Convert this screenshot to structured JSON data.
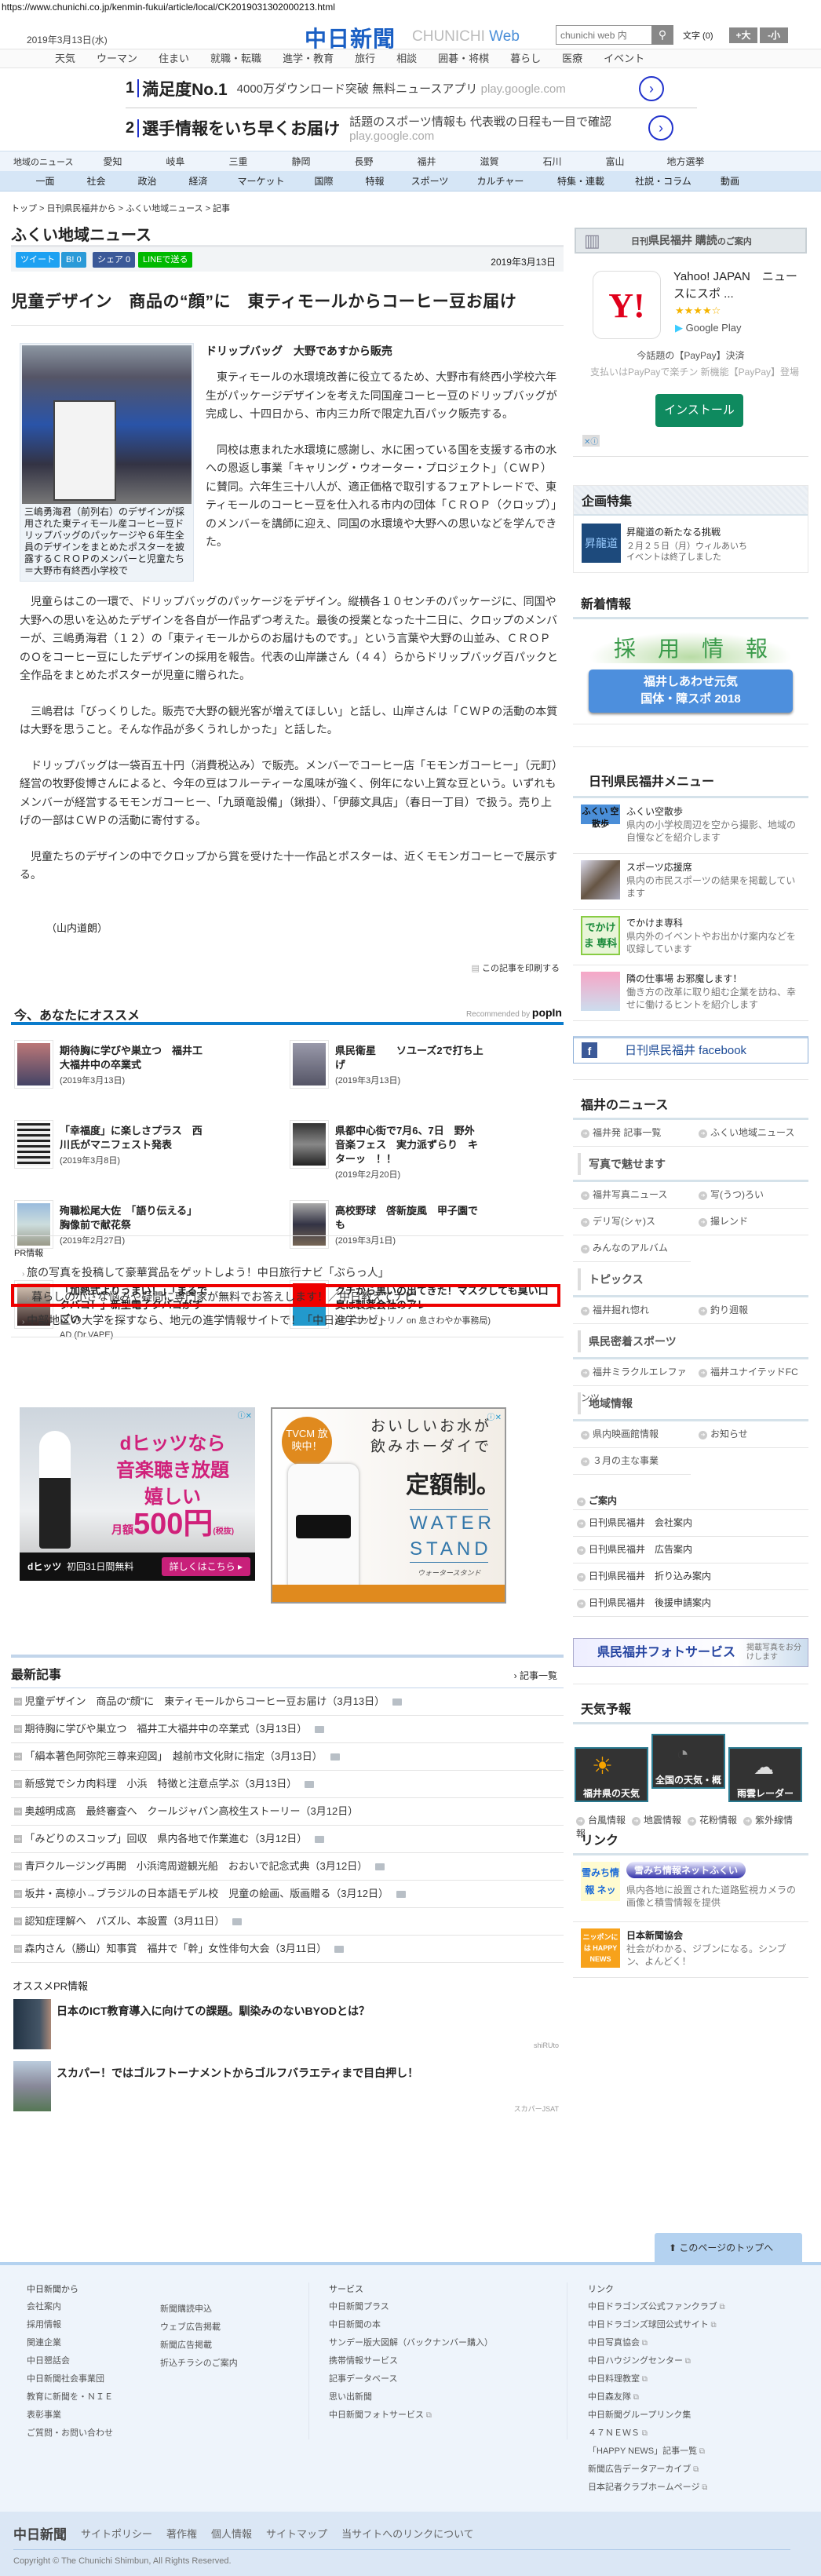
{
  "url": "https://www.chunichi.co.jp/kenmin-fukui/article/local/CK2019031302000213.html",
  "header": {
    "date": "2019年3月13日(水)",
    "logo": "中日新聞",
    "logo_sub": "CHUNICHI",
    "logo_web": "Web",
    "search_placeholder": "chunichi web 内",
    "font_label": "文字 (0)",
    "font_up": "+大",
    "font_down": "-小"
  },
  "top_nav": [
    "天気",
    "ウーマン",
    "住まい",
    "就職・転職",
    "進学・教育",
    "旅行",
    "相談",
    "囲碁・将棋",
    "暮らし",
    "医療",
    "イベント"
  ],
  "top_ad": [
    {
      "num": "1",
      "headline": "満足度No.1",
      "text": "4000万ダウンロード突破 無料ニュースアプリ",
      "domain": "play.google.com"
    },
    {
      "num": "2",
      "headline": "選手情報をいち早くお届け",
      "text": "話題のスポーツ情報も 代表戦の日程も一目で確認",
      "domain": "play.google.com"
    }
  ],
  "region_nav": {
    "title": "地域のニュース",
    "items": [
      "愛知",
      "岐阜",
      "三重",
      "静岡",
      "長野",
      "福井",
      "滋賀",
      "石川",
      "富山",
      "地方選挙"
    ]
  },
  "category_nav": [
    "一面",
    "社会",
    "政治",
    "経済",
    "マーケット",
    "国際",
    "特報",
    "スポーツ",
    "カルチャー",
    "特集・連載",
    "社説・コラム",
    "動画"
  ],
  "breadcrumb": "トップ > 日刊県民福井から > ふくい地域ニュース > 記事",
  "page_title": "ふくい地域ニュース",
  "share": {
    "tweet": "ツイート",
    "hatena": "B! 0",
    "facebook": "シェア 0",
    "line": "LINEで送る",
    "date": "2019年3月13日"
  },
  "article": {
    "headline": "児童デザイン　商品の“顔”に　東ティモールからコーヒー豆お届け",
    "caption": "三嶋勇海君（前列右）のデザインが採用された東ティモール産コーヒー豆ドリップバッグのパッケージや６年生全員のデザインをまとめたポスターを披露するＣＲＯＰのメンバーと児童たち＝大野市有終西小学校で",
    "subhead": "ドリップバッグ　大野であすから販売",
    "paragraphs": [
      "東ティモールの水環境改善に役立てるため、大野市有終西小学校六年生がパッケージデザインを考えた同国産コーヒー豆のドリップバッグが完成し、十四日から、市内三カ所で限定九百パック販売する。",
      "同校は恵まれた水環境に感謝し、水に困っている国を支援する市の水への恩返し事業「キャリング・ウオーター・プロジェクト」（ＣＷＰ）に賛同。六年生三十八人が、適正価格で取引するフェアトレードで、東ティモールのコーヒー豆を仕入れる市内の団体「ＣＲＯＰ（クロップ）」のメンバーを講師に迎え、同国の水環境や大野への思いなどを学んできた。",
      "児童らはこの一環で、ドリップバッグのパッケージをデザイン。縦横各１０センチのパッケージに、同国や大野への思いを込めたデザインを各自が一作品ずつ考えた。最後の授業となった十二日に、クロップのメンバーが、三嶋勇海君（１２）の「東ティモールからのお届けものです。」という言葉や大野の山並み、ＣＲＯＰのＯをコーヒー豆にしたデザインの採用を報告。代表の山岸謙さん（４４）らからドリップバッグ百パックと全作品をまとめたポスターが児童に贈られた。",
      "三嶋君は「びっくりした。販売で大野の観光客が増えてほしい」と話し、山岸さんは「ＣＷＰの活動の本質は大野を思うこと。そんな作品が多くうれしかった」と話した。",
      "ドリップバッグは一袋百五十円（消費税込み）で販売。メンバーでコーヒー店「モモンガコーヒー」（元町）経営の牧野俊博さんによると、今年の豆はフルーティーな風味が強く、例年にない上質な豆という。いずれもメンバーが経営するモモンガコーヒー、「九頭竜設備」（鍬掛）、「伊藤文具店」（春日一丁目）で扱う。売り上げの一部はＣＷＰの活動に寄付する。",
      "児童たちのデザインの中でクロップから賞を受けた十一作品とポスターは、近くモモンガコーヒーで展示する。"
    ],
    "byline": "（山内道朗）",
    "print": "この記事を印刷する"
  },
  "recommend": {
    "title": "今、あなたにオススメ",
    "powered": "Recommended by",
    "brand": "popIn",
    "items": [
      {
        "title": "期待胸に学びや巣立つ　福井工大福井中の卒業式",
        "date": "(2019年3月13日)"
      },
      {
        "title": "県民衛星　　ソユーズ2で打ち上げ",
        "date": "(2019年3月13日)"
      },
      {
        "title": "「幸福度」に楽しさプラス　西川氏がマニフェスト発表",
        "date": "(2019年3月8日)"
      },
      {
        "title": "県都中心街で7月6、7日　野外音楽フェス　実力派ずらり　キターッ　！！",
        "date": "(2019年2月20日)"
      },
      {
        "title": "殉職松尾大佐　「語り伝える」　胸像前で献花祭",
        "date": "(2019年2月27日)"
      },
      {
        "title": "高校野球　啓新旋風　甲子園でも",
        "date": "(2019年3月1日)"
      },
      {
        "title": "「加熱式よりうまい！」「まるでタバコ！」新型電子タバコがすごい",
        "date": "AD (Dr.VAPE)"
      },
      {
        "title": "クチから黒いの出てきた！マスクしても臭い口臭は製薬会社のアレ",
        "date": "AD (ゴッソトリノ on 息さわやか事務局)"
      }
    ]
  },
  "pr": {
    "label": "PR情報",
    "items": [
      "旅の写真を投稿して豪華賞品をゲットしよう！中日旅行ナビ「ぶらっ人」",
      "暮らしの小さな悩みや疑問に専門家が無料でお答えします！／中日教えてナビ",
      "中部地区の大学を探すなら、地元の進学情報サイトで！「中日進学ナビ」"
    ]
  },
  "ads": {
    "dhits": {
      "l1": "dヒッツなら",
      "l2": "音楽聴き放題",
      "l3": "嬉しい",
      "price": "500円",
      "per": "月額",
      "tax": "(税抜)",
      "brand": "dヒッツ",
      "free": "初回31日間無料",
      "cta": "詳しくはこちら ▸"
    },
    "water": {
      "badge": "TVCM 放映中！",
      "l1": "おいしいお水が",
      "l2": "飲みホーダイで",
      "l3": "定額制。",
      "brand1": "WATER",
      "brand2": "STAND",
      "kana": "ウォータースタンド"
    }
  },
  "latest": {
    "title": "最新記事",
    "more": "記事一覧",
    "items": [
      {
        "t": "児童デザイン　商品の“顔”に　東ティモールからコーヒー豆お届け（3月13日）",
        "photo": true
      },
      {
        "t": "期待胸に学びや巣立つ　福井工大福井中の卒業式（3月13日）",
        "photo": true
      },
      {
        "t": "「絹本著色阿弥陀三尊来迎図」　越前市文化財に指定（3月13日）",
        "photo": true
      },
      {
        "t": "新感覚でシカ肉料理　小浜　特徴と注意点学ぶ（3月13日）",
        "photo": true
      },
      {
        "t": "奥越明成高　最終審査へ　クールジャパン高校生ストーリー（3月12日）",
        "photo": false
      },
      {
        "t": "「みどりのスコップ」回収　県内各地で作業進む（3月12日）",
        "photo": true
      },
      {
        "t": "青戸クルージング再開　小浜湾周遊観光船　おおいで記念式典（3月12日）",
        "photo": true
      },
      {
        "t": "坂井・高椋小→ブラジルの日本語モデル校　児童の絵画、版画贈る（3月12日）",
        "photo": true
      },
      {
        "t": "認知症理解へ　パズル、本設置（3月11日）",
        "photo": true
      },
      {
        "t": "森内さん（勝山）知事賞　福井で「幹」女性俳句大会（3月11日）",
        "photo": true
      }
    ]
  },
  "osusume_pr": {
    "title": "オススメPR情報",
    "items": [
      {
        "t": "日本のICT教育導入に向けての課題。馴染みのないBYODとは？",
        "src": "shiRUto"
      },
      {
        "t": "スカパー！ではゴルフトーナメントからゴルフバラエティまで目白押し！",
        "src": "スカパーJSAT"
      }
    ]
  },
  "sidebar": {
    "subscribe": {
      "small": "日刊",
      "big": "県民福井 購読",
      "rest": "のご案内"
    },
    "yahoo_ad": {
      "title": "Yahoo! JAPAN　ニュースにスポ ...",
      "stars": "★★★★☆",
      "store": "Google Play",
      "d1": "今話題の【PayPay】決済",
      "d2": "支払いはPayPayで楽チン 新機能【PayPay】登場",
      "cta": "インストール"
    },
    "kikaku": {
      "title": "企画特集",
      "item": {
        "t": "昇龍道の新たなる挑戦",
        "d1": "２月２５日（月）ウィルあいち",
        "d2": "イベントは終了しました"
      }
    },
    "shinchaku": {
      "title": "新着情報",
      "b1": "採　用　情　報",
      "b2a": "福井しあわせ元気",
      "b2b": "国体・障スポ 2018"
    },
    "menu": {
      "title": "日刊県民福井メニュー",
      "items": [
        {
          "t": "ふくい空散歩",
          "d": "県内の小学校周辺を空から撮影、地域の自慢などを紹介します",
          "th": "ふくい 空散歩"
        },
        {
          "t": "スポーツ応援席",
          "d": "県内の市民スポーツの結果を掲載しています",
          "th": ""
        },
        {
          "t": "でかけま専科",
          "d": "県内外のイベントやお出かけ案内などを収録しています",
          "th": "でかけま 専科"
        },
        {
          "t": "隣の仕事場 お邪魔します！",
          "d": "働き方の改革に取り組む企業を訪ね、幸せに働けるヒントを紹介します",
          "th": ""
        }
      ]
    },
    "facebook": "日刊県民福井 facebook",
    "news": {
      "title": "福井のニュース",
      "top": [
        "福井発 記事一覧",
        "ふくい地域ニュース"
      ],
      "groups": [
        {
          "h": "写真で魅せます",
          "items": [
            "福井写真ニュース",
            "写(うつ)ろい",
            "デリ写(シャ)ス",
            "撮レンド",
            "みんなのアルバム"
          ]
        },
        {
          "h": "トピックス",
          "items": [
            "福井掘れ惚れ",
            "釣り週報"
          ]
        },
        {
          "h": "県民密着スポーツ",
          "items": [
            "福井ミラクルエレファンツ",
            "福井ユナイテッドFC"
          ]
        },
        {
          "h": "地域情報",
          "items": [
            "県内映画館情報",
            "お知らせ",
            "３月の主な事業"
          ]
        }
      ]
    },
    "guide": {
      "title": "ご案内",
      "items": [
        "日刊県民福井　会社案内",
        "日刊県民福井　広告案内",
        "日刊県民福井　折り込み案内",
        "日刊県民福井　後援申請案内"
      ]
    },
    "photo_service": {
      "t": "県民福井フォトサービス",
      "s": "掲載写真をお分けします"
    },
    "weather": {
      "title": "天気予報",
      "tiles": [
        "福井県の天気",
        "全国の天気・概況",
        "雨雲レーダー"
      ],
      "links": [
        "台風情報",
        "地震情報",
        "花粉情報",
        "紫外線情報"
      ]
    },
    "links": {
      "title": "リンク",
      "items": [
        {
          "t": "雪みち情報ネットふくい",
          "d": "県内各地に設置された道路監視カメラの画像と積雪情報を提供",
          "th": "雪みち情報 ネットふくい"
        },
        {
          "t": "日本新聞協会",
          "d": "社会がわかる、ジブンになる。シンブン、よんどく！",
          "th": "ニッポンには HAPPY NEWS"
        }
      ]
    }
  },
  "footer": {
    "page_top": "このページのトップへ",
    "col1": {
      "title": "中日新聞から",
      "a": [
        "会社案内",
        "採用情報",
        "関連企業",
        "中日懇話会",
        "中日新聞社会事業団",
        "教育に新聞を・ＮＩＥ",
        "表彰事業",
        "ご質問・お問い合わせ"
      ],
      "b": [
        "新聞購読申込",
        "ウェブ広告掲載",
        "新聞広告掲載",
        "折込チラシのご案内"
      ]
    },
    "col2": {
      "title": "サービス",
      "items": [
        "中日新聞プラス",
        "中日新聞の本",
        "サンデー版大図解（バックナンバー購入）",
        "携帯情報サービス",
        "記事データベース",
        "思い出新聞",
        "中日新聞フォトサービス"
      ]
    },
    "col3": {
      "title": "リンク",
      "items": [
        "中日ドラゴンズ公式ファンクラブ",
        "中日ドラゴンズ球団公式サイト",
        "中日写真協会",
        "中日ハウジングセンター",
        "中日料理教室",
        "中日森友隊",
        "中日新聞グループリンク集",
        "４７ＮＥＷＳ",
        "「HAPPY NEWS」記事一覧",
        "新聞広告データアーカイブ",
        "日本記者クラブホームページ"
      ]
    },
    "bottom": {
      "logo": "中日新聞",
      "links": [
        "サイトポリシー",
        "著作権",
        "個人情報",
        "サイトマップ",
        "当サイトへのリンクについて"
      ],
      "copyright": "Copyright © The Chunichi Shimbun, All Rights Reserved."
    }
  }
}
